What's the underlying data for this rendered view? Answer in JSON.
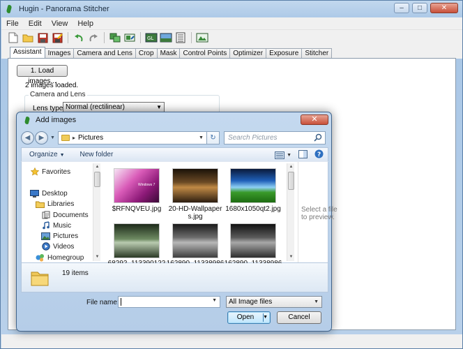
{
  "window": {
    "title": "Hugin - Panorama Stitcher",
    "controls": {
      "minimize": "–",
      "maximize": "□",
      "close": "✕"
    }
  },
  "menu": [
    "File",
    "Edit",
    "View",
    "Help"
  ],
  "toolbar": {
    "icons": [
      "new-project-icon",
      "open-project-icon",
      "save-icon",
      "save-as-icon",
      "undo-icon",
      "redo-icon",
      "control-points-icon",
      "optimize-icon",
      "preview-icon",
      "fast-preview-icon",
      "layout-icon",
      "stitch-icon"
    ]
  },
  "tabs": [
    "Assistant",
    "Images",
    "Camera and Lens",
    "Crop",
    "Mask",
    "Control Points",
    "Optimizer",
    "Exposure",
    "Stitcher"
  ],
  "assistant": {
    "load_button": "1. Load images...",
    "loaded_text": "2 images loaded.",
    "group_title": "Camera and Lens",
    "lens_type_label": "Lens type:",
    "lens_type_value": "Normal (rectilinear)",
    "lens_type_arrow": "▼"
  },
  "dialog": {
    "title": "Add images",
    "close": "✕",
    "nav_back": "◀",
    "nav_forward": "▶",
    "nav_recent": "▼",
    "breadcrumb_separator": "▸",
    "address": "Pictures",
    "address_arrow": "▼",
    "refresh": "↻",
    "search_placeholder": "Search Pictures",
    "commands": {
      "organize": "Organize",
      "organize_caret": "▼",
      "new_folder": "New folder",
      "views_caret": "▼"
    },
    "nav_pane": {
      "favorites": "Favorites",
      "desktop": "Desktop",
      "libraries": "Libraries",
      "documents": "Documents",
      "music": "Music",
      "pictures": "Pictures",
      "videos": "Videos",
      "homegroup": "Homegroup"
    },
    "files": [
      {
        "name": "$RFNQVEU.jpg"
      },
      {
        "name": "20-HD-Wallpaper\ns.jpg"
      },
      {
        "name": "1680x1050qt2.jpg"
      },
      {
        "name": "68292_113390122"
      },
      {
        "name": "162890_11338986"
      },
      {
        "name": "162890_11338986"
      }
    ],
    "thumb_caption": "Windows 7",
    "scroll_up": "▲",
    "scroll_down": "▼",
    "preview_text": "Select a file to preview.",
    "items_count": "19 items",
    "file_name_label": "File name:",
    "file_name_value": "",
    "file_name_arrow": "▼",
    "file_type": "All Image files",
    "file_type_arrow": "▼",
    "open_label": "Open",
    "open_arrow": "▼",
    "cancel_label": "Cancel"
  },
  "colors": {
    "chrome": "#b9d1ea",
    "dialog_border": "#41648b",
    "link_text": "#1e395b"
  }
}
